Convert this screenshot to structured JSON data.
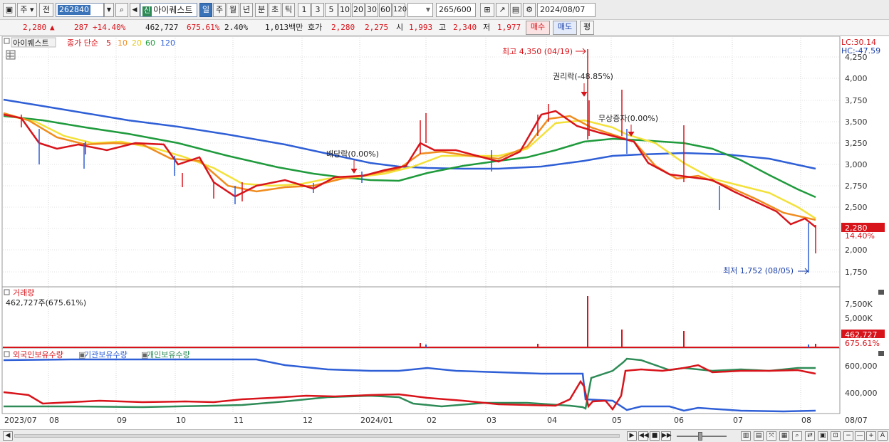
{
  "toolbar": {
    "type_label": "주",
    "prefix_label": "전",
    "code_value": "262840",
    "stock_tag": "신",
    "stock_name": "아이퀘스트",
    "periods": [
      "일",
      "주",
      "월",
      "년",
      "분",
      "초",
      "틱"
    ],
    "active_period": "일",
    "intervals": [
      "1",
      "3",
      "5",
      "10",
      "20",
      "30",
      "60",
      "120"
    ],
    "count_value": "265",
    "count_total": "/600",
    "date_value": "2024/08/07"
  },
  "quote": {
    "price": "2,280",
    "change_arrow": "▲",
    "change": "287",
    "change_pct": "+14.40%",
    "volume": "462,727",
    "volume_ratio": "675.61%",
    "turnover": "2.40%",
    "amount": "1,013백만",
    "bid_label": "호가",
    "bid_1": "2,280",
    "bid_2": "2,275",
    "open_label": "시",
    "open": "1,993",
    "high_label": "고",
    "high": "2,340",
    "low_label": "저",
    "low": "1,977",
    "buy_label": "매수",
    "sell_label": "매도",
    "eval_label": "평"
  },
  "price_panel": {
    "stock_label": "아이퀘스트",
    "ma_label": "종가 단순",
    "ma_periods": [
      "5",
      "10",
      "20",
      "60",
      "120"
    ],
    "ma_colors": [
      "#d8141b",
      "#f08c1e",
      "#f3e13a",
      "#1f9a3c",
      "#2f5fd6"
    ],
    "lc": "LC:30.14",
    "hc": "HC:-47.59",
    "y_ticks": [
      "4,250",
      "4,000",
      "3,750",
      "3,500",
      "3,250",
      "3,000",
      "2,750",
      "2,500",
      "2,250",
      "2,000",
      "1,750"
    ],
    "last_price_tag": "2,280",
    "last_pct_tag": "14.40%",
    "annotations": {
      "high": "최고 4,350 (04/19)",
      "rights": "권리락(-48.85%)",
      "dividend": "배당락(0.00%)",
      "bonus": "무상증자(0.00%)",
      "low": "최저 1,752 (08/05)"
    }
  },
  "volume_panel": {
    "title": "거래량",
    "value_text": "462,727주(675.61%)",
    "y_ticks": [
      "7,500K",
      "5,000K"
    ],
    "last_tag": "462,727",
    "last_pct": "675.61%"
  },
  "holding_panel": {
    "legend": [
      "외국인보유수량",
      "기관보유수량",
      "개인보유수량"
    ],
    "colors": [
      "#d8141b",
      "#2f5fd6",
      "#2e8b57"
    ],
    "y_ticks": [
      "600,000",
      "400,000"
    ]
  },
  "x_axis": [
    "2023/07",
    "08",
    "09",
    "10",
    "11",
    "12",
    "2024/01",
    "02",
    "03",
    "04",
    "05",
    "06",
    "07",
    "08"
  ],
  "x_axis_right": "08/07"
}
